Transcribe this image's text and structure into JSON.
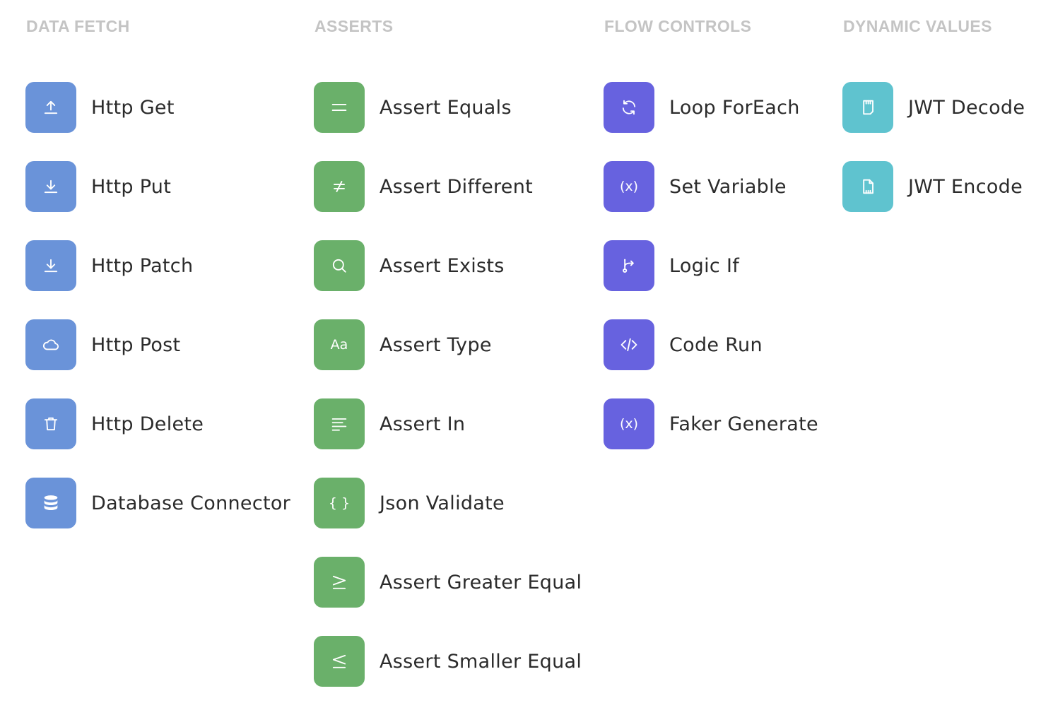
{
  "colors": {
    "heading": "#c4c4c4",
    "label": "#2b2b2b",
    "data_fetch": "#6a93d9",
    "asserts": "#6ab06a",
    "flow_controls": "#6762df",
    "dynamic_values": "#5fc3cf"
  },
  "columns": [
    {
      "title": "DATA FETCH",
      "color": "#6a93d9",
      "items": [
        {
          "label": "Http Get",
          "icon": "upload-icon"
        },
        {
          "label": "Http Put",
          "icon": "download-icon"
        },
        {
          "label": "Http Patch",
          "icon": "download-icon"
        },
        {
          "label": "Http Post",
          "icon": "cloud-icon"
        },
        {
          "label": "Http Delete",
          "icon": "trash-icon"
        },
        {
          "label": "Database Connector",
          "icon": "database-icon"
        }
      ]
    },
    {
      "title": "ASSERTS",
      "color": "#6ab06a",
      "items": [
        {
          "label": "Assert Equals",
          "icon": "equals-icon"
        },
        {
          "label": "Assert Different",
          "icon": "not-equal-icon"
        },
        {
          "label": "Assert Exists",
          "icon": "search-icon"
        },
        {
          "label": "Assert Type",
          "icon": "type-icon",
          "glyph": "Aa"
        },
        {
          "label": "Assert In",
          "icon": "align-left-icon"
        },
        {
          "label": "Json Validate",
          "icon": "braces-icon",
          "glyph": "{ }"
        },
        {
          "label": "Assert Greater Equal",
          "icon": "greater-equal-icon"
        },
        {
          "label": "Assert Smaller Equal",
          "icon": "less-equal-icon"
        }
      ]
    },
    {
      "title": "FLOW CONTROLS",
      "color": "#6762df",
      "items": [
        {
          "label": "Loop ForEach",
          "icon": "refresh-icon"
        },
        {
          "label": "Set Variable",
          "icon": "variable-icon",
          "glyph": "(x)"
        },
        {
          "label": "Logic If",
          "icon": "git-branch-icon"
        },
        {
          "label": "Code Run",
          "icon": "code-icon"
        },
        {
          "label": "Faker Generate",
          "icon": "variable-icon",
          "glyph": "(x)"
        }
      ]
    },
    {
      "title": "DYNAMIC VALUES",
      "color": "#5fc3cf",
      "items": [
        {
          "label": "JWT Decode",
          "icon": "sd-card-icon"
        },
        {
          "label": "JWT Encode",
          "icon": "file-icon"
        }
      ]
    }
  ]
}
